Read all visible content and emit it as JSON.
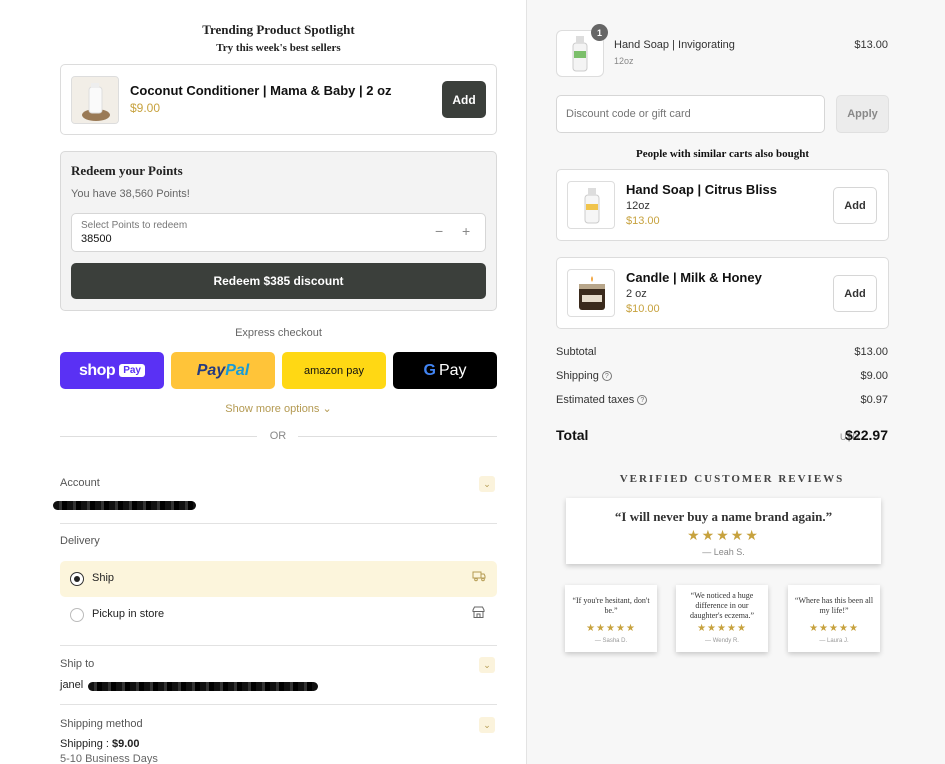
{
  "trending": {
    "title": "Trending Product Spotlight",
    "subtitle": "Try this week's best sellers",
    "product": {
      "name": "Coconut Conditioner | Mama & Baby | 2 oz",
      "price": "$9.00",
      "add_label": "Add"
    }
  },
  "redeem": {
    "title": "Redeem your Points",
    "balance": "You have 38,560 Points!",
    "field_label": "Select Points to redeem",
    "field_value": "38500",
    "minus": "−",
    "plus": "+",
    "button": "Redeem $385 discount"
  },
  "express": {
    "label": "Express checkout",
    "shop_pay": {
      "shop": "shop",
      "pay": "Pay"
    },
    "paypal": {
      "pay": "Pay",
      "pal": "Pal"
    },
    "amazon": "amazon pay",
    "gpay": {
      "g": "G",
      "pay": "Pay"
    },
    "show_more": "Show more options",
    "or": "OR"
  },
  "account": {
    "label": "Account"
  },
  "delivery": {
    "label": "Delivery",
    "options": [
      {
        "label": "Ship",
        "selected": true
      },
      {
        "label": "Pickup in store",
        "selected": false
      }
    ]
  },
  "ship_to": {
    "label": "Ship to",
    "name_prefix": "janel"
  },
  "shipping_method": {
    "label": "Shipping method",
    "line_label": "Shipping",
    "line_sep": ":",
    "price": "$9.00",
    "eta": "5-10 Business Days"
  },
  "cart": {
    "item": {
      "name": "Hand Soap | Invigorating",
      "variant": "12oz",
      "price": "$13.00",
      "qty": "1"
    },
    "discount_placeholder": "Discount code or gift card",
    "apply_label": "Apply"
  },
  "similar": {
    "title": "People with similar carts also bought",
    "items": [
      {
        "name": "Hand Soap | Citrus Bliss",
        "variant": "12oz",
        "price": "$13.00",
        "add_label": "Add"
      },
      {
        "name": "Candle | Milk & Honey",
        "variant": "2 oz",
        "price": "$10.00",
        "add_label": "Add"
      }
    ]
  },
  "summary": {
    "subtotal_label": "Subtotal",
    "subtotal": "$13.00",
    "shipping_label": "Shipping",
    "shipping": "$9.00",
    "taxes_label": "Estimated taxes",
    "taxes": "$0.97",
    "help_glyph": "?",
    "total_label": "Total",
    "currency": "USD",
    "total": "$22.97"
  },
  "reviews": {
    "heading": "VERIFIED CUSTOMER REVIEWS",
    "stars": "★★★★★",
    "main": {
      "quote": "“I will never buy a name brand again.”",
      "author": "— Leah S."
    },
    "small": [
      {
        "quote": "“If you're hesitant, don't be.”",
        "author": "— Sasha D."
      },
      {
        "quote": "“We noticed a huge difference in our daughter's eczema.”",
        "author": "— Wendy R."
      },
      {
        "quote": "“Where has this been all my life!”",
        "author": "— Laura J."
      }
    ]
  },
  "colors": {
    "accent": "#c7a23e",
    "dark_button": "#3b3f3b",
    "selected_bg": "#fcf5dc"
  }
}
